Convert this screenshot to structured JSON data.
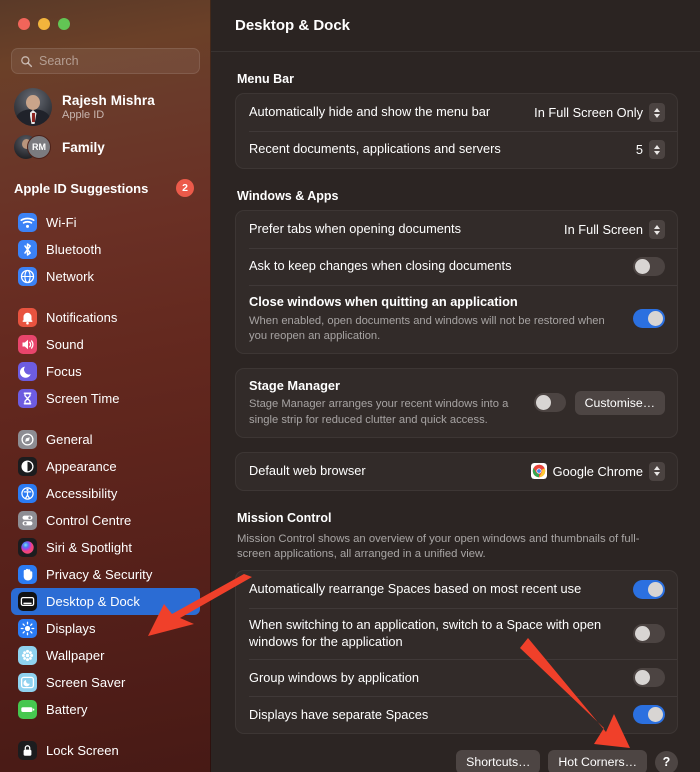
{
  "window": {
    "traffic_lights": [
      "close",
      "minimise",
      "maximise"
    ],
    "title": "Desktop & Dock"
  },
  "sidebar": {
    "search": {
      "placeholder": "Search",
      "value": "",
      "icon": "search-icon"
    },
    "account": {
      "name": "Rajesh Mishra",
      "subtitle": "Apple ID"
    },
    "family": {
      "label": "Family",
      "initials": "RM"
    },
    "suggestions": {
      "label": "Apple ID Suggestions",
      "badge": "2"
    },
    "groups": [
      {
        "items": [
          {
            "label": "Wi-Fi",
            "icon": "wifi-icon"
          },
          {
            "label": "Bluetooth",
            "icon": "bluetooth-icon"
          },
          {
            "label": "Network",
            "icon": "network-icon"
          }
        ]
      },
      {
        "items": [
          {
            "label": "Notifications",
            "icon": "notifications-icon"
          },
          {
            "label": "Sound",
            "icon": "sound-icon"
          },
          {
            "label": "Focus",
            "icon": "focus-icon"
          },
          {
            "label": "Screen Time",
            "icon": "screen-time-icon"
          }
        ]
      },
      {
        "items": [
          {
            "label": "General",
            "icon": "general-icon"
          },
          {
            "label": "Appearance",
            "icon": "appearance-icon"
          },
          {
            "label": "Accessibility",
            "icon": "accessibility-icon"
          },
          {
            "label": "Control Centre",
            "icon": "control-centre-icon"
          },
          {
            "label": "Siri & Spotlight",
            "icon": "siri-icon"
          },
          {
            "label": "Privacy & Security",
            "icon": "privacy-icon"
          },
          {
            "label": "Desktop & Dock",
            "icon": "desktop-dock-icon",
            "selected": true
          },
          {
            "label": "Displays",
            "icon": "displays-icon"
          },
          {
            "label": "Wallpaper",
            "icon": "wallpaper-icon"
          },
          {
            "label": "Screen Saver",
            "icon": "screen-saver-icon"
          },
          {
            "label": "Battery",
            "icon": "battery-icon"
          }
        ]
      },
      {
        "items": [
          {
            "label": "Lock Screen",
            "icon": "lock-screen-icon"
          }
        ]
      }
    ]
  },
  "main": {
    "sections": [
      {
        "title": "Menu Bar",
        "rows": [
          {
            "label": "Automatically hide and show the menu bar",
            "control": "popup",
            "value": "In Full Screen Only"
          },
          {
            "label": "Recent documents, applications and servers",
            "control": "stepper",
            "value": "5"
          }
        ]
      },
      {
        "title": "Windows & Apps",
        "rows": [
          {
            "label": "Prefer tabs when opening documents",
            "control": "popup",
            "value": "In Full Screen"
          },
          {
            "label": "Ask to keep changes when closing documents",
            "control": "toggle",
            "value": "off"
          },
          {
            "label": "Close windows when quitting an application",
            "desc": "When enabled, open documents and windows will not be restored when you reopen an application.",
            "control": "toggle",
            "value": "on"
          }
        ]
      },
      {
        "rows": [
          {
            "label": "Stage Manager",
            "desc": "Stage Manager arranges your recent windows into a single strip for reduced clutter and quick access.",
            "control": "toggle-button",
            "value": "off",
            "button": "Customise…"
          }
        ]
      },
      {
        "rows": [
          {
            "label": "Default web browser",
            "control": "popup-icon",
            "value": "Google Chrome",
            "icon": "chrome-icon"
          }
        ]
      },
      {
        "title": "Mission Control",
        "description": "Mission Control shows an overview of your open windows and thumbnails of full-screen applications, all arranged in a unified view.",
        "rows": [
          {
            "label": "Automatically rearrange Spaces based on most recent use",
            "control": "toggle",
            "value": "on"
          },
          {
            "label": "When switching to an application, switch to a Space with open windows for the application",
            "control": "toggle",
            "value": "off"
          },
          {
            "label": "Group windows by application",
            "control": "toggle",
            "value": "off"
          },
          {
            "label": "Displays have separate Spaces",
            "control": "toggle",
            "value": "on"
          }
        ]
      }
    ],
    "footer": {
      "shortcuts_label": "Shortcuts…",
      "hot_corners_label": "Hot Corners…",
      "help_label": "?"
    }
  },
  "annotations": {
    "arrows": [
      {
        "name": "arrow-to-desktop-and-dock",
        "color": "#f0402a",
        "points_to": "Desktop & Dock"
      },
      {
        "name": "arrow-to-hot-corners",
        "color": "#f0402a",
        "points_to": "Hot Corners…"
      }
    ]
  },
  "colors": {
    "accent_blue": "#2b70e0",
    "selection_blue": "#2b6cd4",
    "badge_red": "#ec5a4a",
    "arrow_red": "#f0402a",
    "main_bg": "#2c2523",
    "card_bg": "#322b29"
  }
}
